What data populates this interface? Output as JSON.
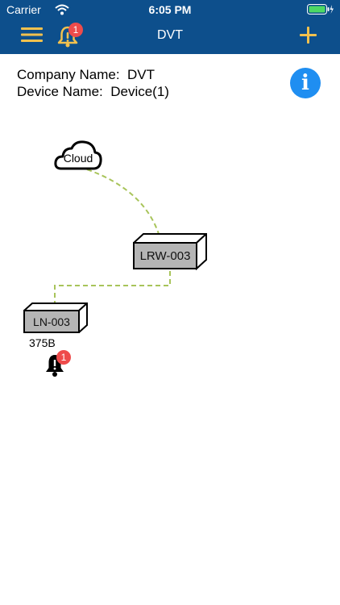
{
  "status_bar": {
    "carrier": "Carrier",
    "time": "6:05 PM"
  },
  "nav": {
    "title": "DVT",
    "alert_count": "1",
    "menu_icon": "hamburger-menu-icon",
    "bell_icon": "bell-icon",
    "add_icon": "plus-icon"
  },
  "info": {
    "company_label": "Company Name:",
    "company_value": "DVT",
    "device_label": "Device Name:",
    "device_value": "Device(1)",
    "info_glyph": "i"
  },
  "topology": {
    "cloud_label": "Cloud",
    "gateway_label": "LRW-003",
    "node_label": "LN-003",
    "node_sublabel": "375B",
    "node_alert_count": "1"
  },
  "colors": {
    "nav_background": "#0d4f8c",
    "nav_icon": "#f2c14e",
    "link_line": "#a8c45a",
    "badge": "#ee4b4b",
    "info_button": "#1f8ef1",
    "device_face": "#b5b5b5"
  }
}
